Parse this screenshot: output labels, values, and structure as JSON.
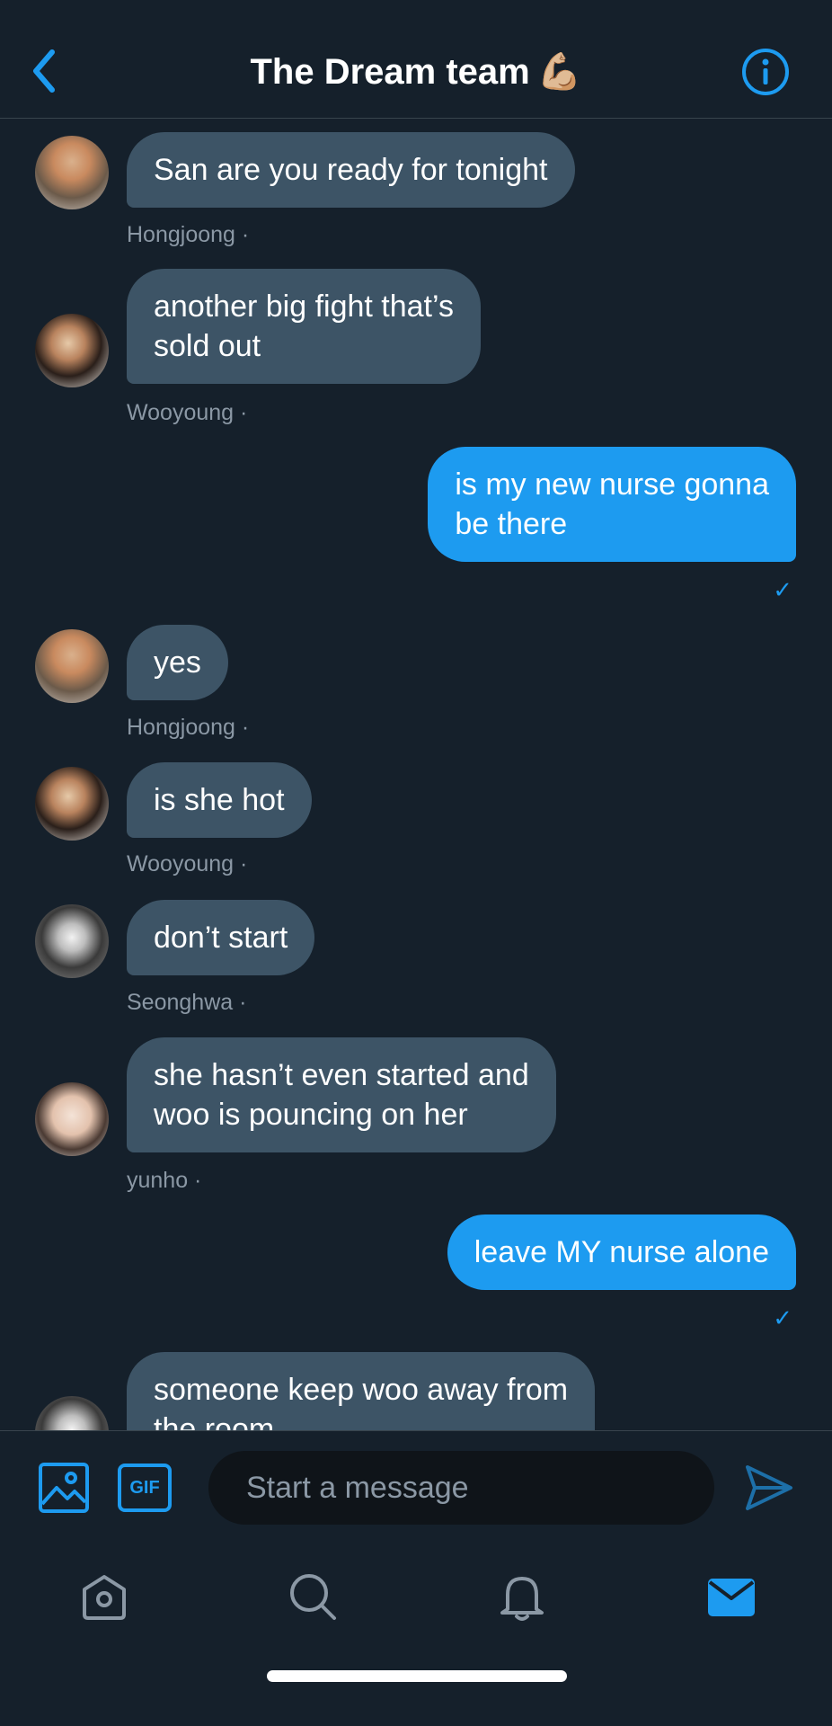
{
  "header": {
    "title": "The Dream team",
    "title_emoji": "💪🏼",
    "back_icon": "chevron-left-icon",
    "info_icon": "info-circle-icon"
  },
  "messages": [
    {
      "direction": "in",
      "text": "San are you ready for tonight",
      "sender": "Hongjoong ·"
    },
    {
      "direction": "in",
      "text": "another big fight that’s\nsold out",
      "sender": "Wooyoung ·"
    },
    {
      "direction": "out",
      "text": "is my new nurse gonna\nbe there",
      "status": "✓"
    },
    {
      "direction": "in",
      "text": "yes",
      "sender": "Hongjoong ·"
    },
    {
      "direction": "in",
      "text": "is she hot",
      "sender": "Wooyoung ·"
    },
    {
      "direction": "in",
      "text": "don’t start",
      "sender": "Seonghwa ·"
    },
    {
      "direction": "in",
      "text": "she hasn’t even started and\nwoo is pouncing on her",
      "sender": "yunho ·"
    },
    {
      "direction": "out",
      "text": "leave MY nurse alone",
      "status": "✓"
    },
    {
      "direction": "in",
      "text": "someone keep woo away from\nthe room",
      "sender": ""
    }
  ],
  "composer": {
    "placeholder": "Start a message",
    "gif_label": "GIF",
    "media_icon": "image-icon",
    "send_icon": "send-icon"
  },
  "tabbar": {
    "items": [
      "home-icon",
      "search-icon",
      "bell-icon",
      "mail-icon"
    ]
  },
  "colors": {
    "background": "#15202b",
    "accent": "#1d9bf0",
    "incoming_bubble": "#3d5466",
    "secondary_text": "#8b98a5"
  }
}
